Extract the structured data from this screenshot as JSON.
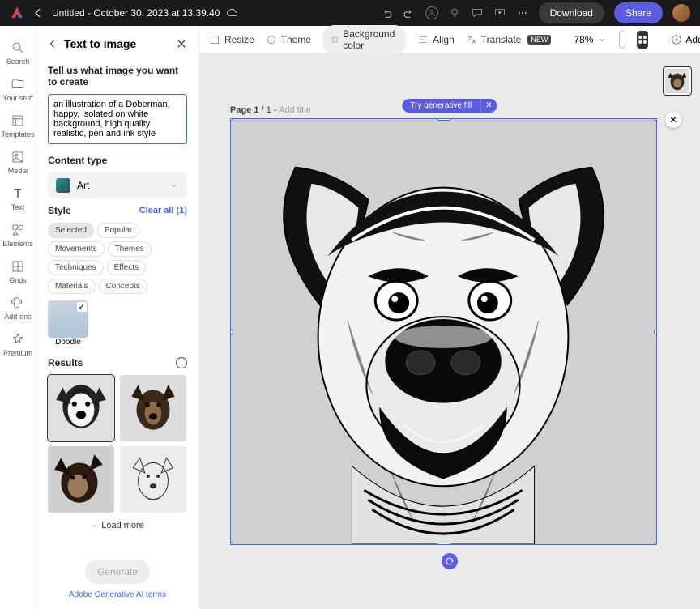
{
  "header": {
    "title": "Untitled - October 30, 2023 at 13.39.40",
    "download": "Download",
    "share": "Share"
  },
  "toolbar": {
    "resize": "Resize",
    "theme": "Theme",
    "bgcolor": "Background color",
    "align": "Align",
    "translate": "Translate",
    "new_badge": "NEW",
    "zoom": "78%",
    "add": "Add"
  },
  "rail": {
    "items": [
      {
        "label": "Search"
      },
      {
        "label": "Your stuff"
      },
      {
        "label": "Templates"
      },
      {
        "label": "Media"
      },
      {
        "label": "Text"
      },
      {
        "label": "Elements"
      },
      {
        "label": "Grids"
      },
      {
        "label": "Add-ons"
      },
      {
        "label": "Premium"
      }
    ]
  },
  "panel": {
    "title": "Text to image",
    "tell_us": "Tell us what image you want to create",
    "prompt": "an illustration of a Doberman, happy, isolated on white background, high quality realistic, pen and ink style",
    "content_type": "Content type",
    "content_value": "Art",
    "style": "Style",
    "clear_all": "Clear all (1)",
    "chips": [
      "Selected",
      "Popular",
      "Movements",
      "Themes",
      "Techniques",
      "Effects",
      "Materials",
      "Concepts"
    ],
    "style_thumb": "Doodle",
    "results": "Results",
    "load_more": "Load more",
    "generate": "Generate",
    "terms": "Adobe Generative AI terms"
  },
  "canvas": {
    "page_label_a": "Page 1",
    "page_label_b": " / 1 - ",
    "page_label_c": "Add title",
    "genfill": "Try generative fill",
    "close": "✕"
  }
}
